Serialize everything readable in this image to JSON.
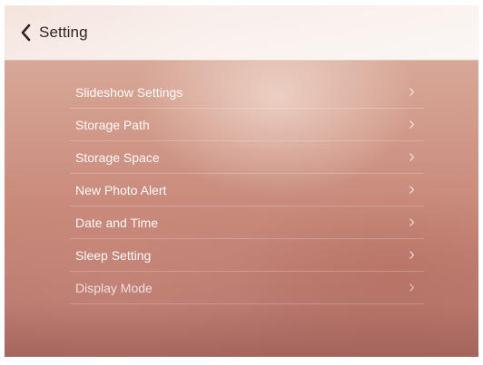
{
  "header": {
    "title": "Setting",
    "back_icon": "chevron-left-icon"
  },
  "menu": {
    "items": [
      {
        "label": "Slideshow Settings"
      },
      {
        "label": "Storage Path"
      },
      {
        "label": "Storage Space"
      },
      {
        "label": "New Photo Alert"
      },
      {
        "label": "Date and Time"
      },
      {
        "label": "Sleep Setting"
      },
      {
        "label": "Display Mode"
      }
    ],
    "item_icon": "chevron-right-icon"
  },
  "colors": {
    "text_primary": "#2f2422",
    "menu_text": "#ffffff",
    "background_top": "#dcb3a3",
    "background_bottom": "#b3726a"
  }
}
